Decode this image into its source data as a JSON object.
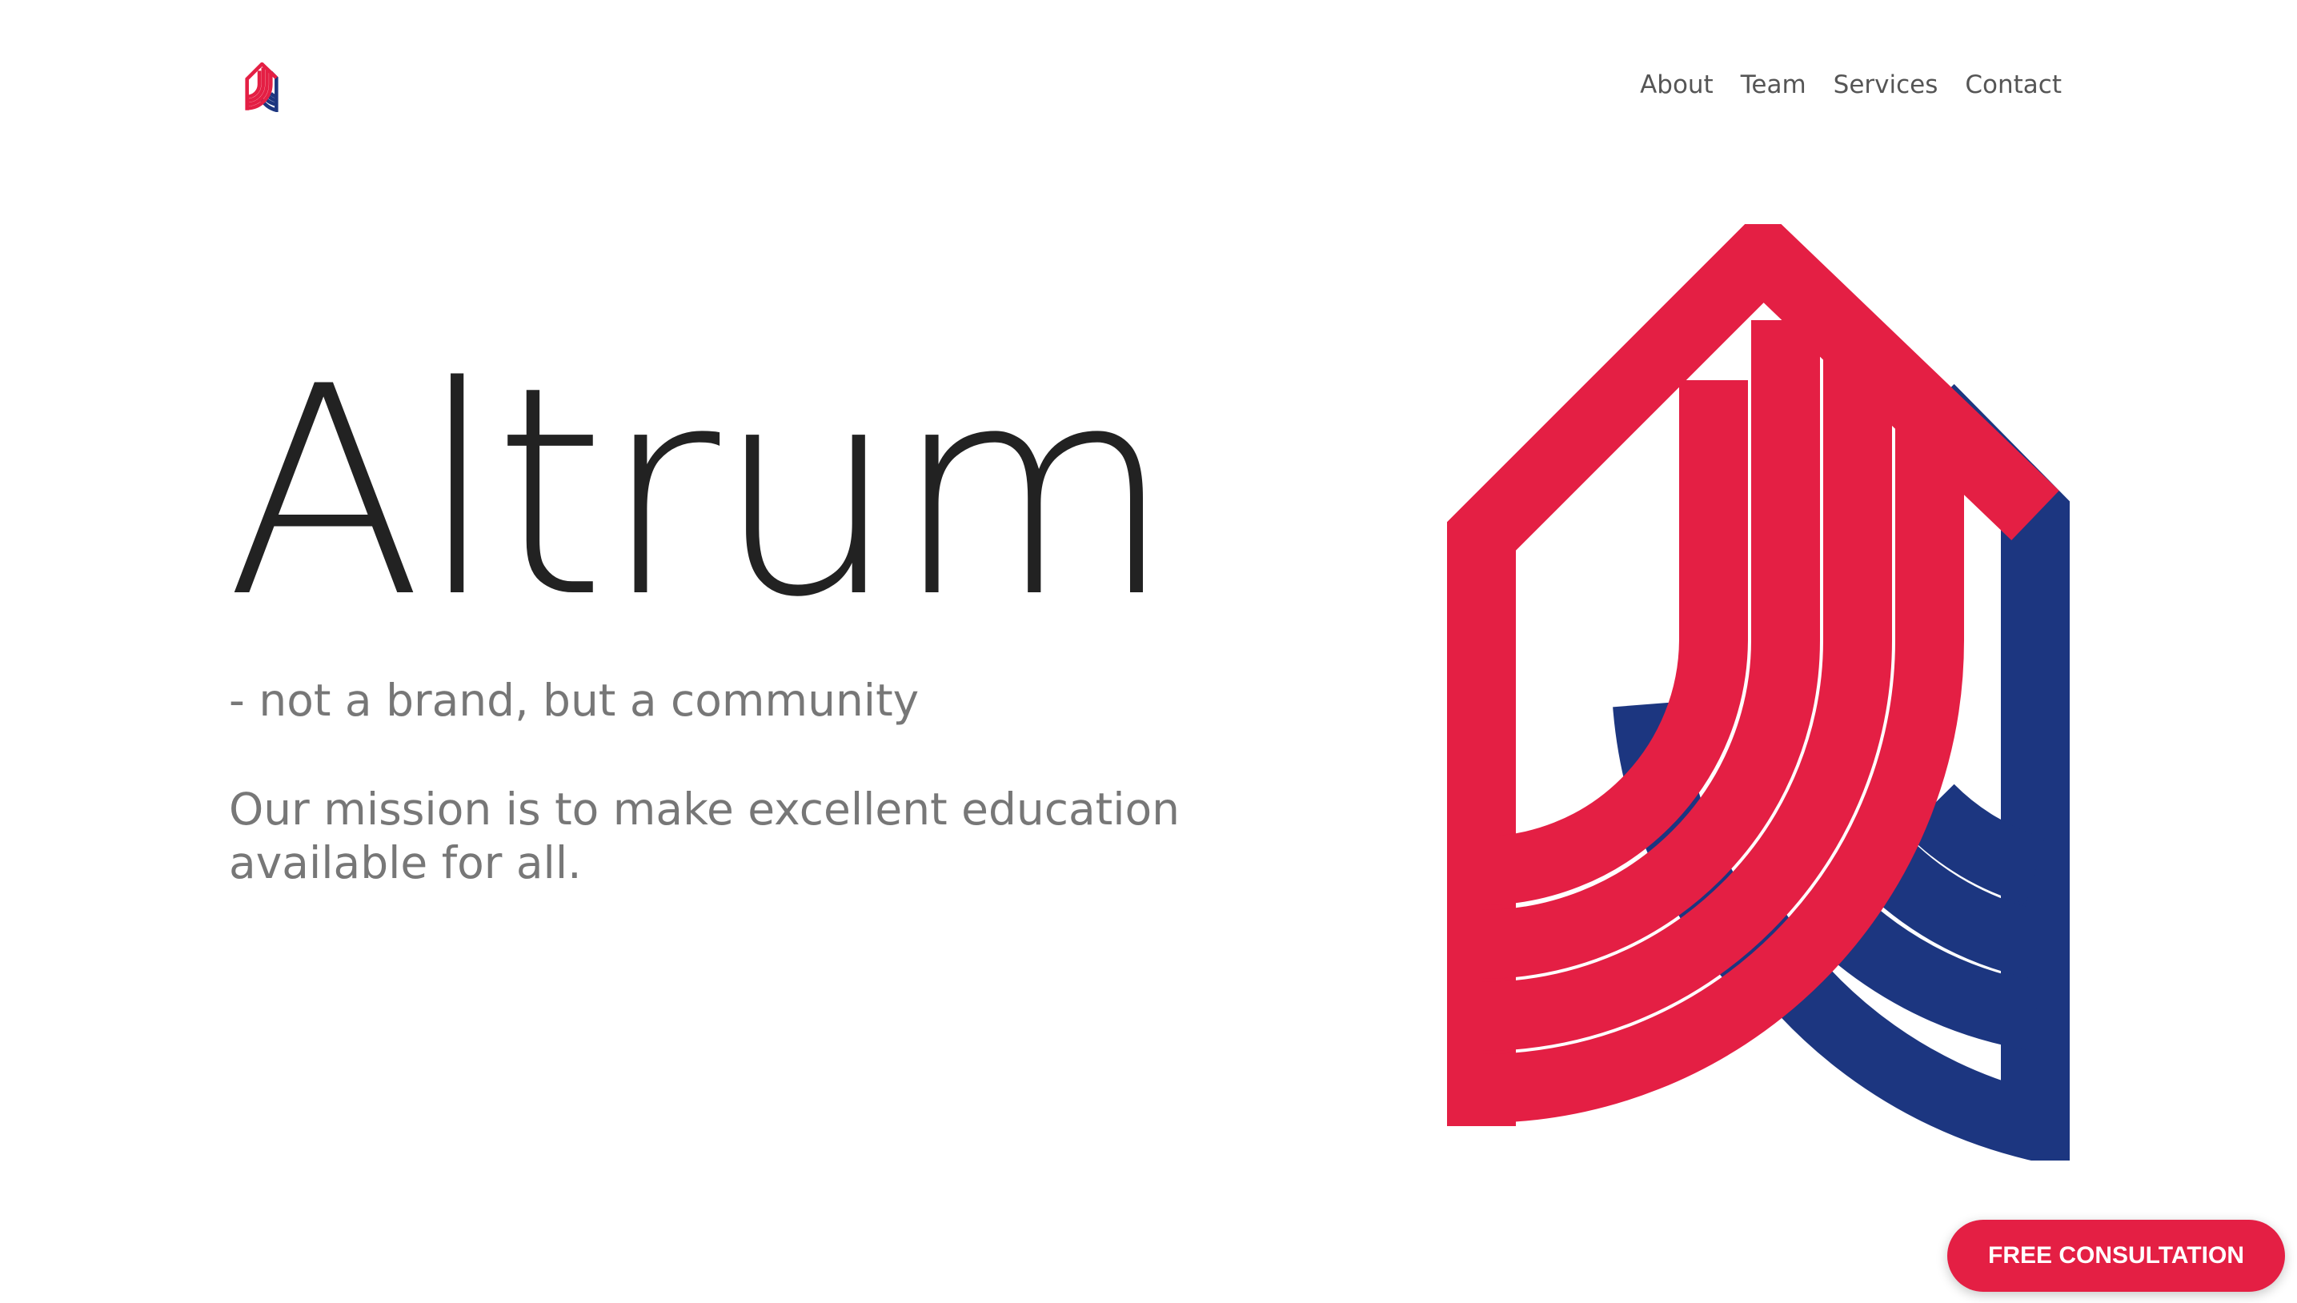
{
  "nav": {
    "items": [
      {
        "label": "About"
      },
      {
        "label": "Team"
      },
      {
        "label": "Services"
      },
      {
        "label": "Contact"
      }
    ]
  },
  "hero": {
    "title": "Altrum",
    "tagline": "- not a brand, but a community",
    "mission": "Our mission is to make excellent education available for all."
  },
  "cta": {
    "label": "FREE CONSULTATION"
  },
  "colors": {
    "brand_red": "#e41f44",
    "brand_blue": "#1c3680",
    "text_dark": "#222222",
    "text_gray": "#777777"
  },
  "icons": {
    "header_logo": "altrum-logo-icon",
    "hero_logo": "altrum-logo-icon"
  }
}
